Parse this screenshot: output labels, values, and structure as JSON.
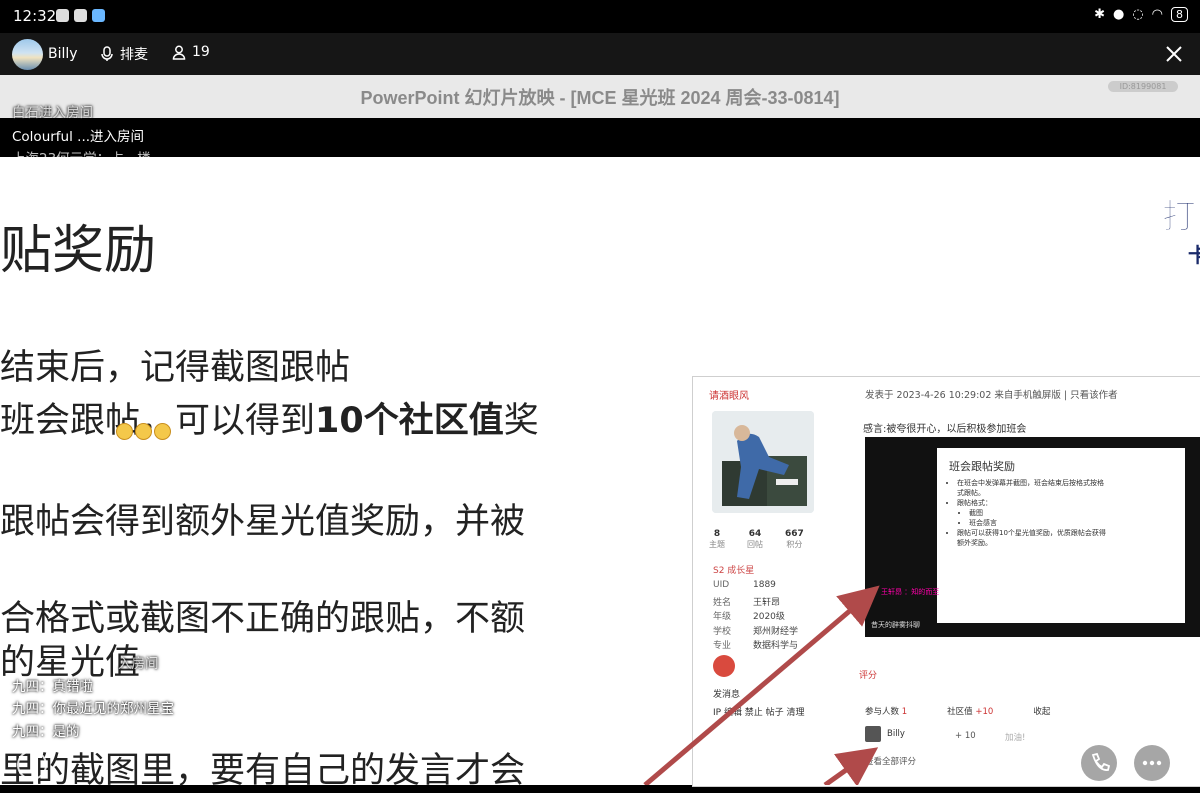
{
  "status_bar": {
    "time": "12:32",
    "battery": "8"
  },
  "room_header": {
    "host_name": "Billy",
    "mic_label": "排麦",
    "viewer_count": "19"
  },
  "slide": {
    "window_title": "PowerPoint 幻灯片放映 - [MCE 星光班 2024 周会-33-0814]",
    "id_badge": "ID:8199081",
    "heading": "贴奖励",
    "lines": [
      "结束后，记得截图跟帖",
      "班会跟帖，可以得到",
      "10个社区值",
      "奖",
      "跟帖会得到额外星光值奖励，并被",
      "合格式或截图不正确的跟贴，不额",
      "的星光值",
      "里的截图里，要有自己的发言才会"
    ]
  },
  "danmaku": [
    "白石进入房间",
    "Colourful ...进入房间",
    "上海23何云学：占一楼",
    "入房间",
    "九四：真错啦",
    "九四：你最近见的郑州星宝",
    "九四：是的"
  ],
  "forum_screenshot": {
    "username": "请酒眼风",
    "post_meta": "发表于 2023-4-26 10:29:02 来自手机触屏版 | 只看该作者",
    "stats": [
      {
        "value": "8",
        "label": "主题"
      },
      {
        "value": "64",
        "label": "回帖"
      },
      {
        "value": "667",
        "label": "积分"
      }
    ],
    "level": "S2 成长星",
    "profile": [
      {
        "key": "UID",
        "value": "1889"
      },
      {
        "key": "姓名",
        "value": "王轩昂"
      },
      {
        "key": "年级",
        "value": "2020级"
      },
      {
        "key": "学校",
        "value": "郑州财经学"
      },
      {
        "key": "专业",
        "value": "数据科学与"
      }
    ],
    "send_message": "发消息",
    "ip_line": "IP 编辑 禁止 帖子 清理",
    "post_text": "感言:被夸很开心，以后积极参加班会",
    "inner_slide_title": "班会跟帖奖励",
    "inner_slide_points": [
      "在班会中发弹幕并截图，班会结束后按格式按格式跟帖。",
      "跟帖格式：",
      "截图",
      "班会感言",
      "跟帖可以获得10个星光值奖励，优质跟帖会获得额外奖励。"
    ],
    "inner_caption": "王轩昂 ：知的而至",
    "inner_caption2": "昔天的辟雾抖聊",
    "rating_label": "评分",
    "participants_label": "参与人数",
    "participants_count": "1",
    "community_label": "社区值",
    "community_total": "+10",
    "collapse_label": "收起",
    "rater_name": "Billy",
    "rater_value": "+ 10",
    "rater_note": "加油!",
    "total_label": "查看全部评分"
  },
  "colors": {
    "accent_arrow": "#b04a4a",
    "slide_bg": "#ffffff",
    "header_bg": "#161616"
  },
  "icons": {
    "close": "close-icon",
    "mic": "mic-icon",
    "people": "people-icon",
    "call": "phone-icon",
    "more": "more-icon"
  }
}
